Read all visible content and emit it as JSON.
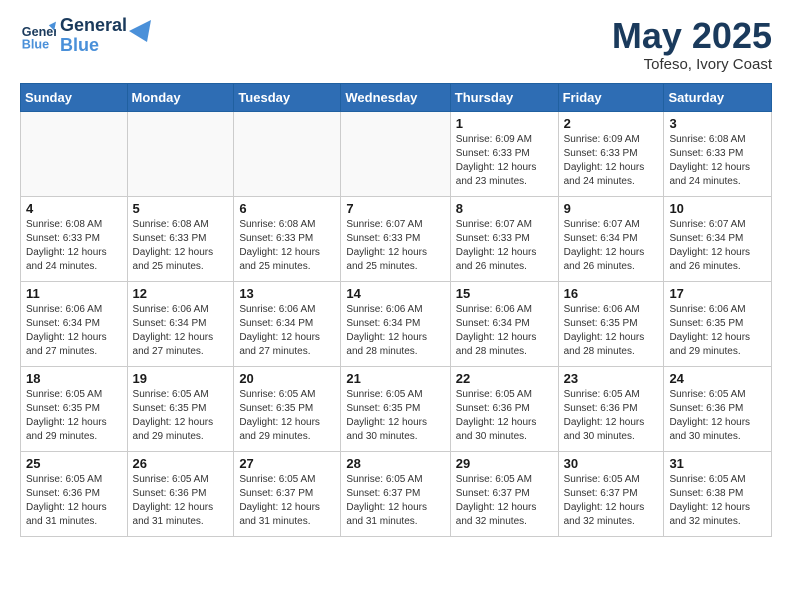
{
  "header": {
    "logo_line1": "General",
    "logo_line2": "Blue",
    "month": "May 2025",
    "location": "Tofeso, Ivory Coast"
  },
  "weekdays": [
    "Sunday",
    "Monday",
    "Tuesday",
    "Wednesday",
    "Thursday",
    "Friday",
    "Saturday"
  ],
  "weeks": [
    [
      {
        "day": "",
        "info": ""
      },
      {
        "day": "",
        "info": ""
      },
      {
        "day": "",
        "info": ""
      },
      {
        "day": "",
        "info": ""
      },
      {
        "day": "1",
        "info": "Sunrise: 6:09 AM\nSunset: 6:33 PM\nDaylight: 12 hours\nand 23 minutes."
      },
      {
        "day": "2",
        "info": "Sunrise: 6:09 AM\nSunset: 6:33 PM\nDaylight: 12 hours\nand 24 minutes."
      },
      {
        "day": "3",
        "info": "Sunrise: 6:08 AM\nSunset: 6:33 PM\nDaylight: 12 hours\nand 24 minutes."
      }
    ],
    [
      {
        "day": "4",
        "info": "Sunrise: 6:08 AM\nSunset: 6:33 PM\nDaylight: 12 hours\nand 24 minutes."
      },
      {
        "day": "5",
        "info": "Sunrise: 6:08 AM\nSunset: 6:33 PM\nDaylight: 12 hours\nand 25 minutes."
      },
      {
        "day": "6",
        "info": "Sunrise: 6:08 AM\nSunset: 6:33 PM\nDaylight: 12 hours\nand 25 minutes."
      },
      {
        "day": "7",
        "info": "Sunrise: 6:07 AM\nSunset: 6:33 PM\nDaylight: 12 hours\nand 25 minutes."
      },
      {
        "day": "8",
        "info": "Sunrise: 6:07 AM\nSunset: 6:33 PM\nDaylight: 12 hours\nand 26 minutes."
      },
      {
        "day": "9",
        "info": "Sunrise: 6:07 AM\nSunset: 6:34 PM\nDaylight: 12 hours\nand 26 minutes."
      },
      {
        "day": "10",
        "info": "Sunrise: 6:07 AM\nSunset: 6:34 PM\nDaylight: 12 hours\nand 26 minutes."
      }
    ],
    [
      {
        "day": "11",
        "info": "Sunrise: 6:06 AM\nSunset: 6:34 PM\nDaylight: 12 hours\nand 27 minutes."
      },
      {
        "day": "12",
        "info": "Sunrise: 6:06 AM\nSunset: 6:34 PM\nDaylight: 12 hours\nand 27 minutes."
      },
      {
        "day": "13",
        "info": "Sunrise: 6:06 AM\nSunset: 6:34 PM\nDaylight: 12 hours\nand 27 minutes."
      },
      {
        "day": "14",
        "info": "Sunrise: 6:06 AM\nSunset: 6:34 PM\nDaylight: 12 hours\nand 28 minutes."
      },
      {
        "day": "15",
        "info": "Sunrise: 6:06 AM\nSunset: 6:34 PM\nDaylight: 12 hours\nand 28 minutes."
      },
      {
        "day": "16",
        "info": "Sunrise: 6:06 AM\nSunset: 6:35 PM\nDaylight: 12 hours\nand 28 minutes."
      },
      {
        "day": "17",
        "info": "Sunrise: 6:06 AM\nSunset: 6:35 PM\nDaylight: 12 hours\nand 29 minutes."
      }
    ],
    [
      {
        "day": "18",
        "info": "Sunrise: 6:05 AM\nSunset: 6:35 PM\nDaylight: 12 hours\nand 29 minutes."
      },
      {
        "day": "19",
        "info": "Sunrise: 6:05 AM\nSunset: 6:35 PM\nDaylight: 12 hours\nand 29 minutes."
      },
      {
        "day": "20",
        "info": "Sunrise: 6:05 AM\nSunset: 6:35 PM\nDaylight: 12 hours\nand 29 minutes."
      },
      {
        "day": "21",
        "info": "Sunrise: 6:05 AM\nSunset: 6:35 PM\nDaylight: 12 hours\nand 30 minutes."
      },
      {
        "day": "22",
        "info": "Sunrise: 6:05 AM\nSunset: 6:36 PM\nDaylight: 12 hours\nand 30 minutes."
      },
      {
        "day": "23",
        "info": "Sunrise: 6:05 AM\nSunset: 6:36 PM\nDaylight: 12 hours\nand 30 minutes."
      },
      {
        "day": "24",
        "info": "Sunrise: 6:05 AM\nSunset: 6:36 PM\nDaylight: 12 hours\nand 30 minutes."
      }
    ],
    [
      {
        "day": "25",
        "info": "Sunrise: 6:05 AM\nSunset: 6:36 PM\nDaylight: 12 hours\nand 31 minutes."
      },
      {
        "day": "26",
        "info": "Sunrise: 6:05 AM\nSunset: 6:36 PM\nDaylight: 12 hours\nand 31 minutes."
      },
      {
        "day": "27",
        "info": "Sunrise: 6:05 AM\nSunset: 6:37 PM\nDaylight: 12 hours\nand 31 minutes."
      },
      {
        "day": "28",
        "info": "Sunrise: 6:05 AM\nSunset: 6:37 PM\nDaylight: 12 hours\nand 31 minutes."
      },
      {
        "day": "29",
        "info": "Sunrise: 6:05 AM\nSunset: 6:37 PM\nDaylight: 12 hours\nand 32 minutes."
      },
      {
        "day": "30",
        "info": "Sunrise: 6:05 AM\nSunset: 6:37 PM\nDaylight: 12 hours\nand 32 minutes."
      },
      {
        "day": "31",
        "info": "Sunrise: 6:05 AM\nSunset: 6:38 PM\nDaylight: 12 hours\nand 32 minutes."
      }
    ]
  ]
}
